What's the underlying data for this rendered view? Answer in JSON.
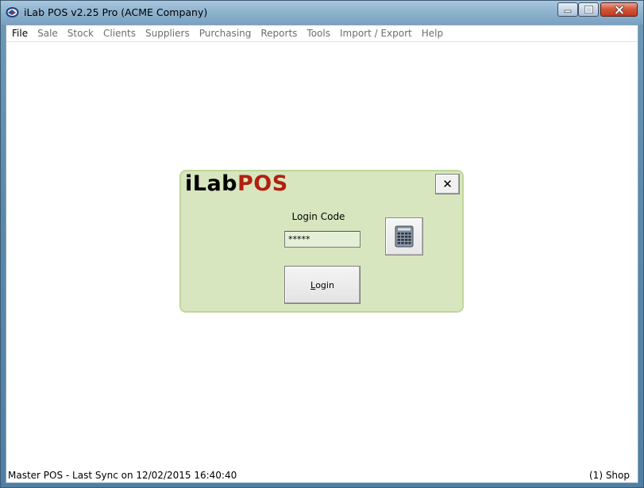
{
  "window": {
    "title": "iLab POS v2.25 Pro (ACME Company)",
    "icon": "app-logo-icon"
  },
  "menu": {
    "items": [
      {
        "label": "File",
        "active": true
      },
      {
        "label": "Sale",
        "active": false
      },
      {
        "label": "Stock",
        "active": false
      },
      {
        "label": "Clients",
        "active": false
      },
      {
        "label": "Suppliers",
        "active": false
      },
      {
        "label": "Purchasing",
        "active": false
      },
      {
        "label": "Reports",
        "active": false
      },
      {
        "label": "Tools",
        "active": false
      },
      {
        "label": "Import / Export",
        "active": false
      },
      {
        "label": "Help",
        "active": false
      }
    ]
  },
  "login": {
    "logo_part1": "iLab",
    "logo_part2": "POS",
    "close_label": "✕",
    "code_label": "Login Code",
    "code_value": "*****",
    "keypad_icon": "keypad-icon",
    "login_button_underlined": "L",
    "login_button_rest": "ogin"
  },
  "status": {
    "left": "Master POS - Last Sync on 12/02/2015 16:40:40",
    "right": "(1) Shop"
  },
  "colors": {
    "panel_bg": "#d8e6bf",
    "panel_border": "#bfd79a",
    "logo_red": "#b22010",
    "titlebar": "#8fb3cf",
    "close_red": "#c3391f"
  }
}
